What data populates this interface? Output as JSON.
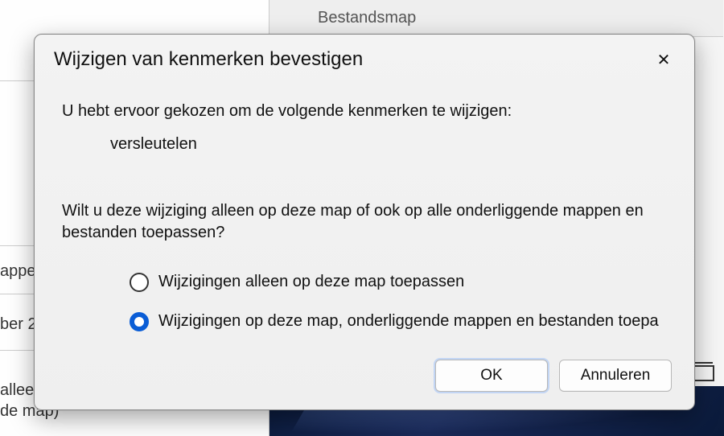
{
  "background": {
    "header_tab_label": "Bestandsmap",
    "left_fragments": {
      "a": "appe",
      "b": "ber 2",
      "c": "allee",
      "d": "de map)"
    }
  },
  "dialog": {
    "title": "Wijzigen van kenmerken bevestigen",
    "intro": "U hebt ervoor gekozen om de volgende kenmerken te wijzigen:",
    "attribute": "versleutelen",
    "question": "Wilt u deze wijziging alleen op deze map of ook op alle onderliggende mappen en bestanden toepassen?",
    "options": [
      {
        "label": "Wijzigingen alleen op deze map toepassen",
        "selected": false
      },
      {
        "label": "Wijzigingen op deze map, onderliggende mappen en bestanden toepa",
        "selected": true
      }
    ],
    "buttons": {
      "ok": "OK",
      "cancel": "Annuleren"
    }
  }
}
